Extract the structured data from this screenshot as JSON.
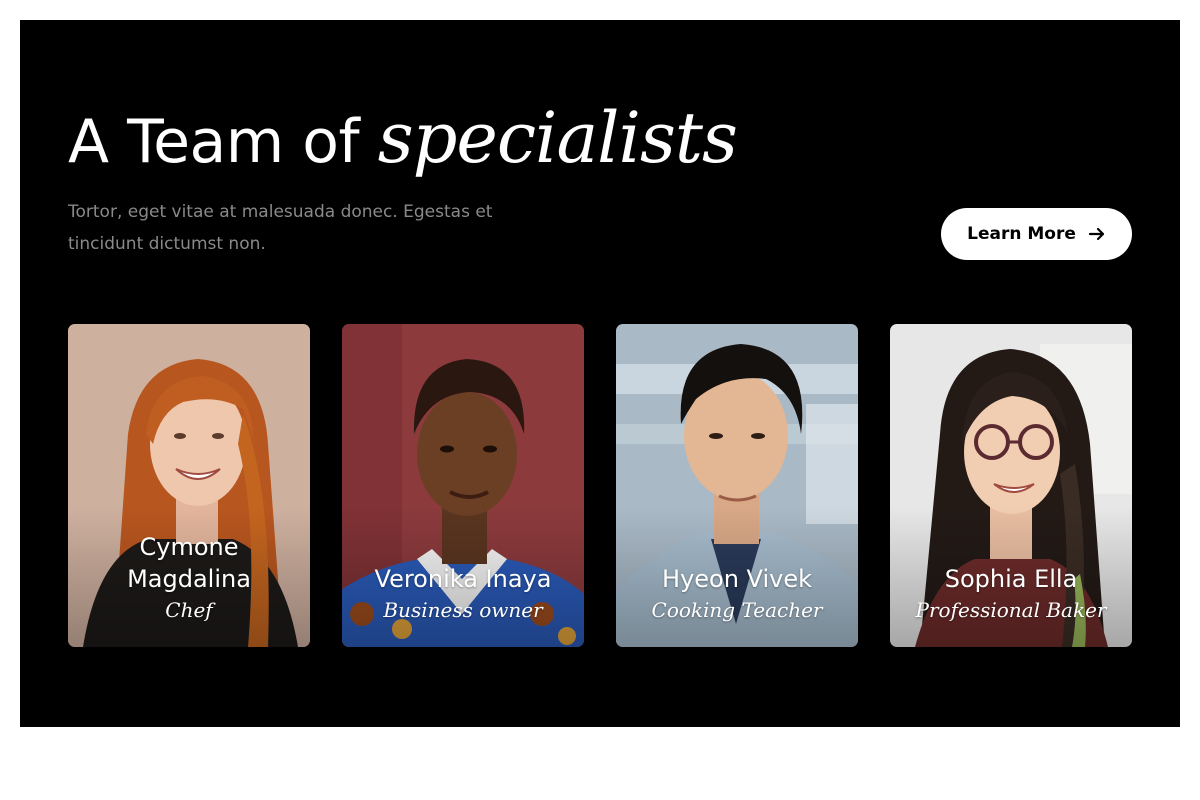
{
  "heading": {
    "plain": "A Team of",
    "emphasis": "specialists"
  },
  "subtitle": "Tortor, eget vitae at malesuada donec. Egestas et tincidunt dictumst non.",
  "cta": {
    "label": "Learn More",
    "icon": "arrow-right-icon"
  },
  "colors": {
    "section_bg": "#000000",
    "page_bg": "#ffffff",
    "heading": "#ffffff",
    "subtitle": "#8a8a8a",
    "cta_bg": "#ffffff",
    "cta_text": "#000000"
  },
  "team": [
    {
      "name": "Cymone Magdalina",
      "role": "Chef"
    },
    {
      "name": "Veronika Inaya",
      "role": "Business owner"
    },
    {
      "name": "Hyeon Vivek",
      "role": "Cooking Teacher"
    },
    {
      "name": "Sophia Ella",
      "role": "Professional Baker"
    }
  ]
}
